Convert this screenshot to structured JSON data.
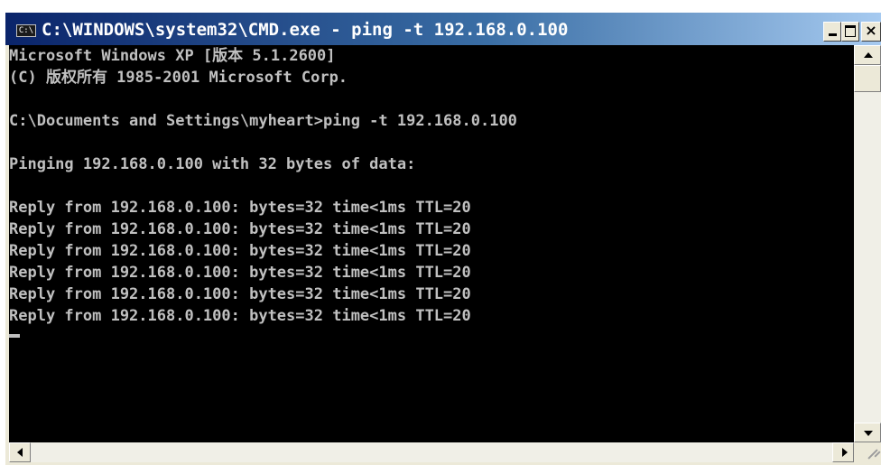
{
  "window": {
    "title": "C:\\WINDOWS\\system32\\CMD.exe - ping -t 192.168.0.100",
    "icon": "cmd-icon",
    "icon_label": "C:\\",
    "controls": {
      "minimize": "minimize-icon",
      "maximize": "maximize-icon",
      "close_glyph": "×"
    }
  },
  "console": {
    "lines": [
      "Microsoft Windows XP [版本 5.1.2600]",
      "(C) 版权所有 1985-2001 Microsoft Corp.",
      "",
      "C:\\Documents and Settings\\myheart>ping -t 192.168.0.100",
      "",
      "Pinging 192.168.0.100 with 32 bytes of data:",
      "",
      "Reply from 192.168.0.100: bytes=32 time<1ms TTL=20",
      "Reply from 192.168.0.100: bytes=32 time<1ms TTL=20",
      "Reply from 192.168.0.100: bytes=32 time<1ms TTL=20",
      "Reply from 192.168.0.100: bytes=32 time<1ms TTL=20",
      "Reply from 192.168.0.100: bytes=32 time<1ms TTL=20",
      "Reply from 192.168.0.100: bytes=32 time<1ms TTL=20"
    ],
    "text_color": "#c0c0c0",
    "background": "#000000"
  },
  "scrollbars": {
    "vertical_position": 0,
    "horizontal_position": 0
  }
}
